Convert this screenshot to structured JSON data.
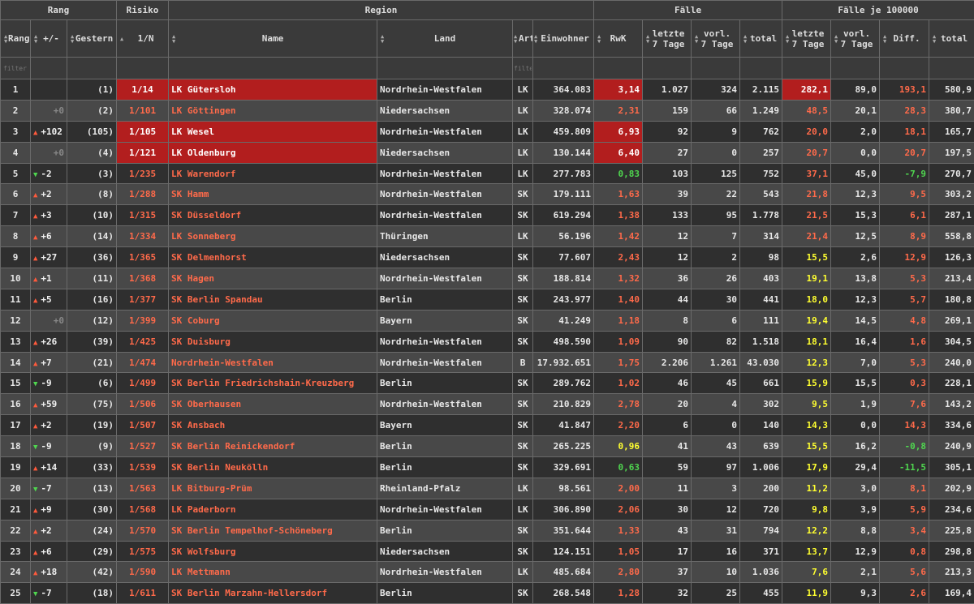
{
  "groups": {
    "rang": "Rang",
    "risiko": "Risiko",
    "region": "Region",
    "faelle": "Fälle",
    "faelle100k": "Fälle je 100000"
  },
  "headers": {
    "rang": "Rang",
    "pm": "+/-",
    "gestern": "Gestern",
    "risk": "1/N",
    "name": "Name",
    "land": "Land",
    "art": "Art",
    "einw": "Einwohner",
    "rwk": "RwK",
    "l7a": "letzte",
    "l7b": "7 Tage",
    "v7a": "vorl.",
    "v7b": "7 Tage",
    "total": "total",
    "pl7a": "letzte",
    "pl7b": "7 Tage",
    "pv7a": "vorl.",
    "pv7b": "7 Tage",
    "diff": "Diff.",
    "ptotal": "total"
  },
  "filters": {
    "rang_placeholder": "filter",
    "art_placeholder": "filte"
  },
  "colors": {
    "highlight": "#b21e1e",
    "up": "#ff5a3c",
    "down": "#4fd64f",
    "yellow": "#ffff30"
  },
  "rows": [
    {
      "rank": "1",
      "dir": "",
      "chg": "",
      "gest": "(1)",
      "risk": "1/14",
      "name": "LK Gütersloh",
      "land": "Nordrhein-Westfalen",
      "art": "LK",
      "einw": "364.083",
      "rwk": "3,14",
      "l7": "1.027",
      "v7": "324",
      "tot": "2.115",
      "pl7": "282,1",
      "pv7": "89,0",
      "diff": "193,1",
      "ptot": "580,9",
      "hl": true,
      "rwkHl": true,
      "pl7Hl": true,
      "rwkC": "white",
      "pl7C": "white",
      "diffC": "red",
      "nameC": "white"
    },
    {
      "rank": "2",
      "dir": "zero",
      "chg": "+0",
      "gest": "(2)",
      "risk": "1/101",
      "name": "LK Göttingen",
      "land": "Niedersachsen",
      "art": "LK",
      "einw": "328.074",
      "rwk": "2,31",
      "l7": "159",
      "v7": "66",
      "tot": "1.249",
      "pl7": "48,5",
      "pv7": "20,1",
      "diff": "28,3",
      "ptot": "380,7",
      "hl": false,
      "rwkC": "red",
      "pl7C": "red",
      "diffC": "red",
      "nameC": "red"
    },
    {
      "rank": "3",
      "dir": "up",
      "chg": "+102",
      "gest": "(105)",
      "risk": "1/105",
      "name": "LK Wesel",
      "land": "Nordrhein-Westfalen",
      "art": "LK",
      "einw": "459.809",
      "rwk": "6,93",
      "l7": "92",
      "v7": "9",
      "tot": "762",
      "pl7": "20,0",
      "pv7": "2,0",
      "diff": "18,1",
      "ptot": "165,7",
      "hl": true,
      "rwkHl": true,
      "rwkC": "white",
      "pl7C": "red",
      "diffC": "red",
      "nameC": "white"
    },
    {
      "rank": "4",
      "dir": "zero",
      "chg": "+0",
      "gest": "(4)",
      "risk": "1/121",
      "name": "LK Oldenburg",
      "land": "Niedersachsen",
      "art": "LK",
      "einw": "130.144",
      "rwk": "6,40",
      "l7": "27",
      "v7": "0",
      "tot": "257",
      "pl7": "20,7",
      "pv7": "0,0",
      "diff": "20,7",
      "ptot": "197,5",
      "hl": true,
      "rwkHl": true,
      "rwkC": "white",
      "pl7C": "red",
      "diffC": "red",
      "nameC": "white"
    },
    {
      "rank": "5",
      "dir": "down",
      "chg": "-2",
      "gest": "(3)",
      "risk": "1/235",
      "name": "LK Warendorf",
      "land": "Nordrhein-Westfalen",
      "art": "LK",
      "einw": "277.783",
      "rwk": "0,83",
      "l7": "103",
      "v7": "125",
      "tot": "752",
      "pl7": "37,1",
      "pv7": "45,0",
      "diff": "-7,9",
      "ptot": "270,7",
      "hl": false,
      "rwkC": "green",
      "pl7C": "red",
      "diffC": "green",
      "nameC": "red"
    },
    {
      "rank": "6",
      "dir": "up",
      "chg": "+2",
      "gest": "(8)",
      "risk": "1/288",
      "name": "SK Hamm",
      "land": "Nordrhein-Westfalen",
      "art": "SK",
      "einw": "179.111",
      "rwk": "1,63",
      "l7": "39",
      "v7": "22",
      "tot": "543",
      "pl7": "21,8",
      "pv7": "12,3",
      "diff": "9,5",
      "ptot": "303,2",
      "hl": false,
      "rwkC": "red",
      "pl7C": "red",
      "diffC": "red",
      "nameC": "red"
    },
    {
      "rank": "7",
      "dir": "up",
      "chg": "+3",
      "gest": "(10)",
      "risk": "1/315",
      "name": "SK Düsseldorf",
      "land": "Nordrhein-Westfalen",
      "art": "SK",
      "einw": "619.294",
      "rwk": "1,38",
      "l7": "133",
      "v7": "95",
      "tot": "1.778",
      "pl7": "21,5",
      "pv7": "15,3",
      "diff": "6,1",
      "ptot": "287,1",
      "hl": false,
      "rwkC": "red",
      "pl7C": "red",
      "diffC": "red",
      "nameC": "red"
    },
    {
      "rank": "8",
      "dir": "up",
      "chg": "+6",
      "gest": "(14)",
      "risk": "1/334",
      "name": "LK Sonneberg",
      "land": "Thüringen",
      "art": "LK",
      "einw": "56.196",
      "rwk": "1,42",
      "l7": "12",
      "v7": "7",
      "tot": "314",
      "pl7": "21,4",
      "pv7": "12,5",
      "diff": "8,9",
      "ptot": "558,8",
      "hl": false,
      "rwkC": "red",
      "pl7C": "red",
      "diffC": "red",
      "nameC": "red"
    },
    {
      "rank": "9",
      "dir": "up",
      "chg": "+27",
      "gest": "(36)",
      "risk": "1/365",
      "name": "SK Delmenhorst",
      "land": "Niedersachsen",
      "art": "SK",
      "einw": "77.607",
      "rwk": "2,43",
      "l7": "12",
      "v7": "2",
      "tot": "98",
      "pl7": "15,5",
      "pv7": "2,6",
      "diff": "12,9",
      "ptot": "126,3",
      "hl": false,
      "rwkC": "red",
      "pl7C": "yellow",
      "diffC": "red",
      "nameC": "red"
    },
    {
      "rank": "10",
      "dir": "up",
      "chg": "+1",
      "gest": "(11)",
      "risk": "1/368",
      "name": "SK Hagen",
      "land": "Nordrhein-Westfalen",
      "art": "SK",
      "einw": "188.814",
      "rwk": "1,32",
      "l7": "36",
      "v7": "26",
      "tot": "403",
      "pl7": "19,1",
      "pv7": "13,8",
      "diff": "5,3",
      "ptot": "213,4",
      "hl": false,
      "rwkC": "red",
      "pl7C": "yellow",
      "diffC": "red",
      "nameC": "red"
    },
    {
      "rank": "11",
      "dir": "up",
      "chg": "+5",
      "gest": "(16)",
      "risk": "1/377",
      "name": "SK Berlin Spandau",
      "land": "Berlin",
      "art": "SK",
      "einw": "243.977",
      "rwk": "1,40",
      "l7": "44",
      "v7": "30",
      "tot": "441",
      "pl7": "18,0",
      "pv7": "12,3",
      "diff": "5,7",
      "ptot": "180,8",
      "hl": false,
      "rwkC": "red",
      "pl7C": "yellow",
      "diffC": "red",
      "nameC": "red"
    },
    {
      "rank": "12",
      "dir": "zero",
      "chg": "+0",
      "gest": "(12)",
      "risk": "1/399",
      "name": "SK Coburg",
      "land": "Bayern",
      "art": "SK",
      "einw": "41.249",
      "rwk": "1,18",
      "l7": "8",
      "v7": "6",
      "tot": "111",
      "pl7": "19,4",
      "pv7": "14,5",
      "diff": "4,8",
      "ptot": "269,1",
      "hl": false,
      "rwkC": "red",
      "pl7C": "yellow",
      "diffC": "red",
      "nameC": "red"
    },
    {
      "rank": "13",
      "dir": "up",
      "chg": "+26",
      "gest": "(39)",
      "risk": "1/425",
      "name": "SK Duisburg",
      "land": "Nordrhein-Westfalen",
      "art": "SK",
      "einw": "498.590",
      "rwk": "1,09",
      "l7": "90",
      "v7": "82",
      "tot": "1.518",
      "pl7": "18,1",
      "pv7": "16,4",
      "diff": "1,6",
      "ptot": "304,5",
      "hl": false,
      "rwkC": "red",
      "pl7C": "yellow",
      "diffC": "red",
      "nameC": "red"
    },
    {
      "rank": "14",
      "dir": "up",
      "chg": "+7",
      "gest": "(21)",
      "risk": "1/474",
      "name": "Nordrhein-Westfalen",
      "land": "Nordrhein-Westfalen",
      "art": "B",
      "einw": "17.932.651",
      "rwk": "1,75",
      "l7": "2.206",
      "v7": "1.261",
      "tot": "43.030",
      "pl7": "12,3",
      "pv7": "7,0",
      "diff": "5,3",
      "ptot": "240,0",
      "hl": false,
      "rwkC": "red",
      "pl7C": "yellow",
      "diffC": "red",
      "nameC": "red"
    },
    {
      "rank": "15",
      "dir": "down",
      "chg": "-9",
      "gest": "(6)",
      "risk": "1/499",
      "name": "SK Berlin Friedrichshain-Kreuzberg",
      "land": "Berlin",
      "art": "SK",
      "einw": "289.762",
      "rwk": "1,02",
      "l7": "46",
      "v7": "45",
      "tot": "661",
      "pl7": "15,9",
      "pv7": "15,5",
      "diff": "0,3",
      "ptot": "228,1",
      "hl": false,
      "rwkC": "red",
      "pl7C": "yellow",
      "diffC": "red",
      "nameC": "red"
    },
    {
      "rank": "16",
      "dir": "up",
      "chg": "+59",
      "gest": "(75)",
      "risk": "1/506",
      "name": "SK Oberhausen",
      "land": "Nordrhein-Westfalen",
      "art": "SK",
      "einw": "210.829",
      "rwk": "2,78",
      "l7": "20",
      "v7": "4",
      "tot": "302",
      "pl7": "9,5",
      "pv7": "1,9",
      "diff": "7,6",
      "ptot": "143,2",
      "hl": false,
      "rwkC": "red",
      "pl7C": "yellow",
      "diffC": "red",
      "nameC": "red"
    },
    {
      "rank": "17",
      "dir": "up",
      "chg": "+2",
      "gest": "(19)",
      "risk": "1/507",
      "name": "SK Ansbach",
      "land": "Bayern",
      "art": "SK",
      "einw": "41.847",
      "rwk": "2,20",
      "l7": "6",
      "v7": "0",
      "tot": "140",
      "pl7": "14,3",
      "pv7": "0,0",
      "diff": "14,3",
      "ptot": "334,6",
      "hl": false,
      "rwkC": "red",
      "pl7C": "yellow",
      "diffC": "red",
      "nameC": "red"
    },
    {
      "rank": "18",
      "dir": "down",
      "chg": "-9",
      "gest": "(9)",
      "risk": "1/527",
      "name": "SK Berlin Reinickendorf",
      "land": "Berlin",
      "art": "SK",
      "einw": "265.225",
      "rwk": "0,96",
      "l7": "41",
      "v7": "43",
      "tot": "639",
      "pl7": "15,5",
      "pv7": "16,2",
      "diff": "-0,8",
      "ptot": "240,9",
      "hl": false,
      "rwkC": "yellow",
      "pl7C": "yellow",
      "diffC": "green",
      "nameC": "red"
    },
    {
      "rank": "19",
      "dir": "up",
      "chg": "+14",
      "gest": "(33)",
      "risk": "1/539",
      "name": "SK Berlin Neukölln",
      "land": "Berlin",
      "art": "SK",
      "einw": "329.691",
      "rwk": "0,63",
      "l7": "59",
      "v7": "97",
      "tot": "1.006",
      "pl7": "17,9",
      "pv7": "29,4",
      "diff": "-11,5",
      "ptot": "305,1",
      "hl": false,
      "rwkC": "green",
      "pl7C": "yellow",
      "diffC": "green",
      "nameC": "red"
    },
    {
      "rank": "20",
      "dir": "down",
      "chg": "-7",
      "gest": "(13)",
      "risk": "1/563",
      "name": "LK Bitburg-Prüm",
      "land": "Rheinland-Pfalz",
      "art": "LK",
      "einw": "98.561",
      "rwk": "2,00",
      "l7": "11",
      "v7": "3",
      "tot": "200",
      "pl7": "11,2",
      "pv7": "3,0",
      "diff": "8,1",
      "ptot": "202,9",
      "hl": false,
      "rwkC": "red",
      "pl7C": "yellow",
      "diffC": "red",
      "nameC": "red"
    },
    {
      "rank": "21",
      "dir": "up",
      "chg": "+9",
      "gest": "(30)",
      "risk": "1/568",
      "name": "LK Paderborn",
      "land": "Nordrhein-Westfalen",
      "art": "LK",
      "einw": "306.890",
      "rwk": "2,06",
      "l7": "30",
      "v7": "12",
      "tot": "720",
      "pl7": "9,8",
      "pv7": "3,9",
      "diff": "5,9",
      "ptot": "234,6",
      "hl": false,
      "rwkC": "red",
      "pl7C": "yellow",
      "diffC": "red",
      "nameC": "red"
    },
    {
      "rank": "22",
      "dir": "up",
      "chg": "+2",
      "gest": "(24)",
      "risk": "1/570",
      "name": "SK Berlin Tempelhof-Schöneberg",
      "land": "Berlin",
      "art": "SK",
      "einw": "351.644",
      "rwk": "1,33",
      "l7": "43",
      "v7": "31",
      "tot": "794",
      "pl7": "12,2",
      "pv7": "8,8",
      "diff": "3,4",
      "ptot": "225,8",
      "hl": false,
      "rwkC": "red",
      "pl7C": "yellow",
      "diffC": "red",
      "nameC": "red"
    },
    {
      "rank": "23",
      "dir": "up",
      "chg": "+6",
      "gest": "(29)",
      "risk": "1/575",
      "name": "SK Wolfsburg",
      "land": "Niedersachsen",
      "art": "SK",
      "einw": "124.151",
      "rwk": "1,05",
      "l7": "17",
      "v7": "16",
      "tot": "371",
      "pl7": "13,7",
      "pv7": "12,9",
      "diff": "0,8",
      "ptot": "298,8",
      "hl": false,
      "rwkC": "red",
      "pl7C": "yellow",
      "diffC": "red",
      "nameC": "red"
    },
    {
      "rank": "24",
      "dir": "up",
      "chg": "+18",
      "gest": "(42)",
      "risk": "1/590",
      "name": "LK Mettmann",
      "land": "Nordrhein-Westfalen",
      "art": "LK",
      "einw": "485.684",
      "rwk": "2,80",
      "l7": "37",
      "v7": "10",
      "tot": "1.036",
      "pl7": "7,6",
      "pv7": "2,1",
      "diff": "5,6",
      "ptot": "213,3",
      "hl": false,
      "rwkC": "red",
      "pl7C": "yellow",
      "diffC": "red",
      "nameC": "red"
    },
    {
      "rank": "25",
      "dir": "down",
      "chg": "-7",
      "gest": "(18)",
      "risk": "1/611",
      "name": "SK Berlin Marzahn-Hellersdorf",
      "land": "Berlin",
      "art": "SK",
      "einw": "268.548",
      "rwk": "1,28",
      "l7": "32",
      "v7": "25",
      "tot": "455",
      "pl7": "11,9",
      "pv7": "9,3",
      "diff": "2,6",
      "ptot": "169,4",
      "hl": false,
      "rwkC": "red",
      "pl7C": "yellow",
      "diffC": "red",
      "nameC": "red"
    }
  ]
}
